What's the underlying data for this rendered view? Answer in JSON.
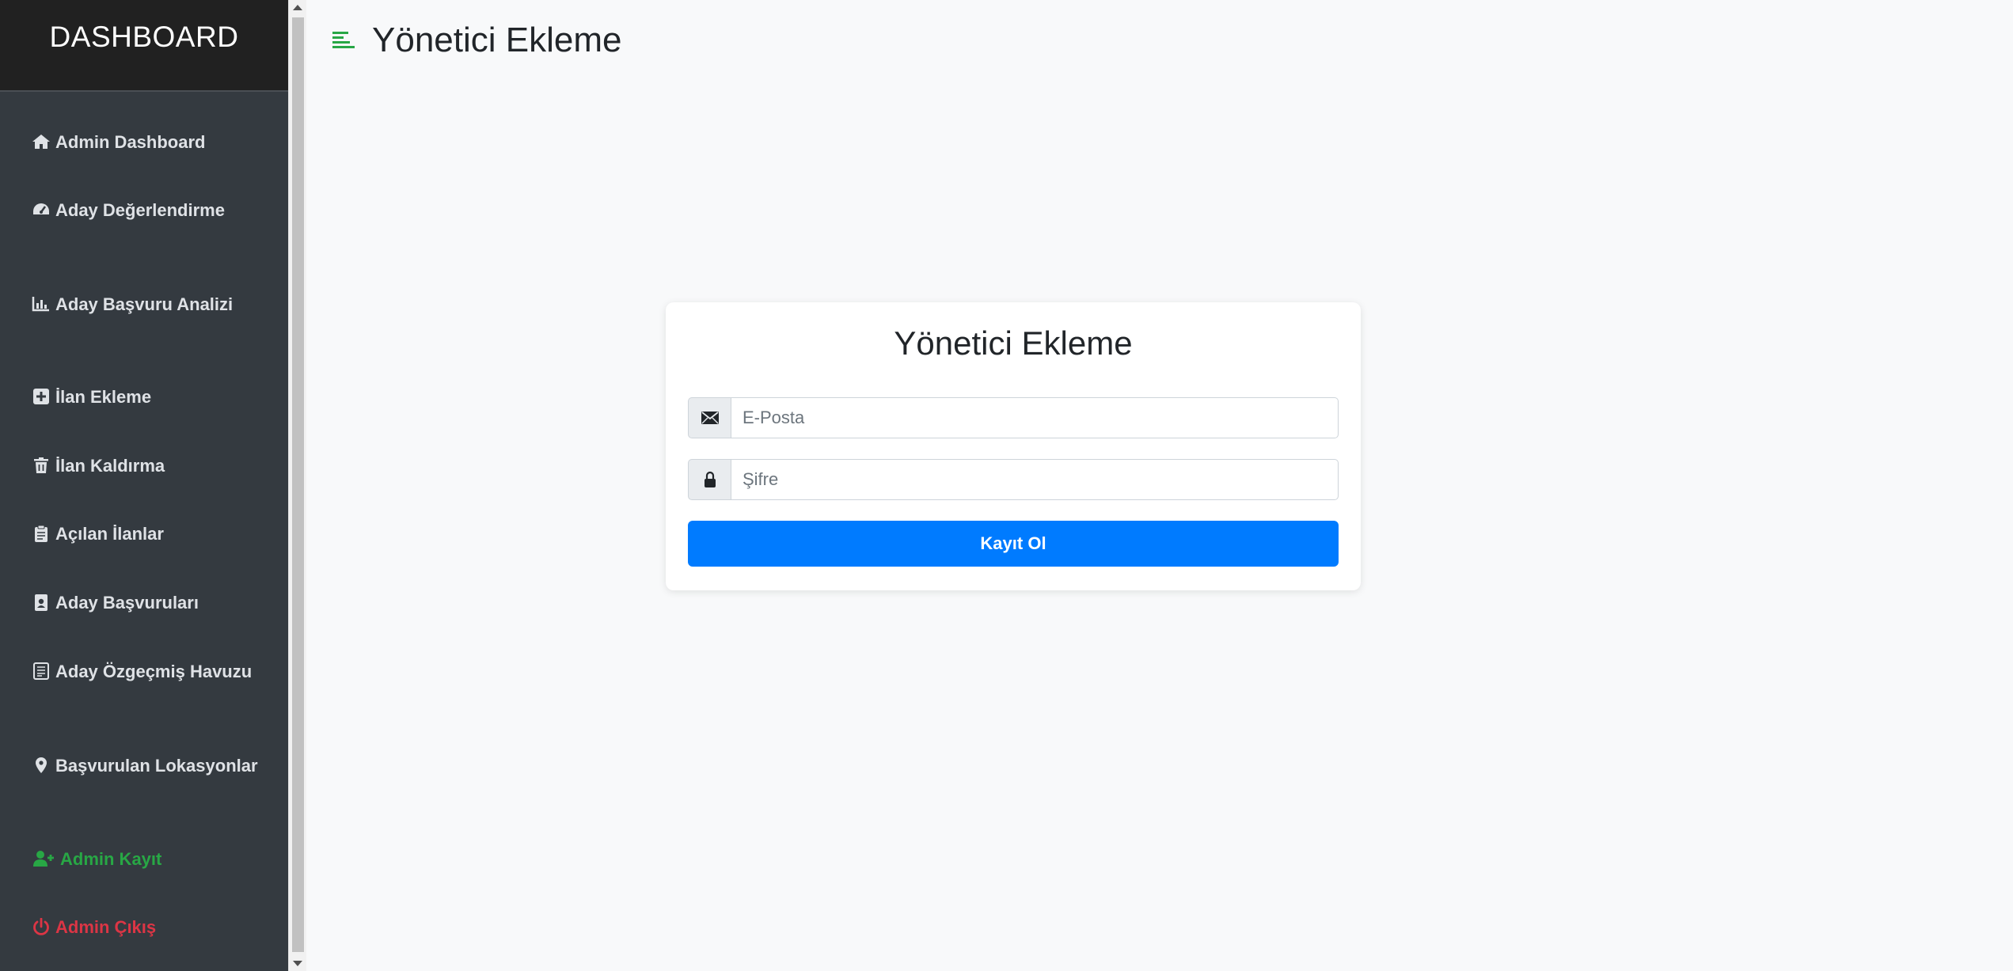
{
  "sidebar": {
    "brand": "DASHBOARD",
    "items": [
      {
        "label": "Admin Dashboard",
        "icon": "home-icon"
      },
      {
        "label": "Aday Değerlendirme",
        "icon": "tachometer-icon"
      },
      {
        "label": "Aday Başvuru Analizi",
        "icon": "bar-chart-icon"
      },
      {
        "label": "İlan Ekleme",
        "icon": "plus-square-icon"
      },
      {
        "label": "İlan Kaldırma",
        "icon": "trash-icon"
      },
      {
        "label": "Açılan İlanlar",
        "icon": "clipboard-icon"
      },
      {
        "label": "Aday Başvuruları",
        "icon": "id-badge-icon"
      },
      {
        "label": "Aday Özgeçmiş Havuzu",
        "icon": "file-text-icon"
      },
      {
        "label": "Başvurulan Lokasyonlar",
        "icon": "map-marker-icon"
      },
      {
        "label": "Admin Kayıt",
        "icon": "user-plus-icon"
      },
      {
        "label": "Admin Çıkış",
        "icon": "power-icon"
      }
    ]
  },
  "header": {
    "title": "Yönetici Ekleme",
    "menu_icon": "menu-align-left-icon"
  },
  "form": {
    "title": "Yönetici Ekleme",
    "email_placeholder": "E-Posta",
    "email_icon": "envelope-icon",
    "password_placeholder": "Şifre",
    "password_icon": "lock-icon",
    "submit_label": "Kayıt Ol"
  },
  "colors": {
    "sidebar_bg": "#343a40",
    "sidebar_header_bg": "#212121",
    "accent_green": "#28a745",
    "danger_red": "#dc3545",
    "primary_blue": "#007bff",
    "page_bg": "#f8f9fa"
  }
}
